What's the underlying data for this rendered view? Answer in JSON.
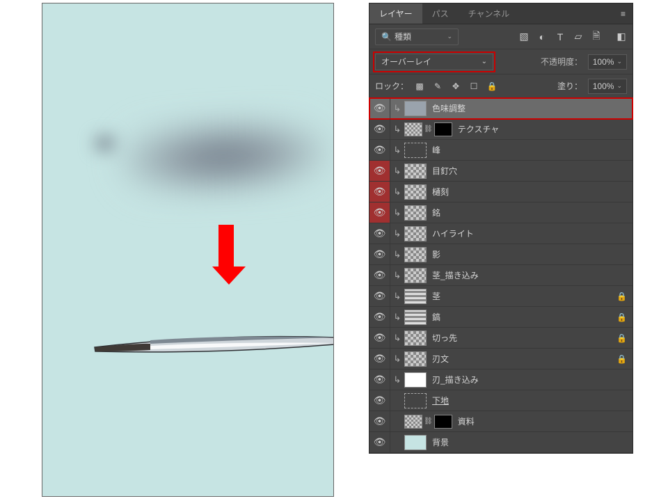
{
  "canvas": {
    "arrow_color": "#ff0000"
  },
  "panel": {
    "tabs": {
      "layers": "レイヤー",
      "paths": "パス",
      "channels": "チャンネル"
    },
    "filter": {
      "kind_label": "種類"
    },
    "blend": {
      "mode": "オーバーレイ",
      "opacity_label": "不透明度：",
      "opacity_value": "100%"
    },
    "lock": {
      "label": "ロック：",
      "fill_label": "塗り：",
      "fill_value": "100%"
    },
    "layers": [
      {
        "name": "色味調整",
        "selected": true,
        "toggled": false,
        "clip": true,
        "thumb": "gray",
        "locked": false
      },
      {
        "name": "テクスチャ",
        "selected": false,
        "toggled": false,
        "clip": true,
        "thumb": "linkmask",
        "locked": false
      },
      {
        "name": "峰",
        "selected": false,
        "toggled": false,
        "clip": true,
        "thumb": "artboard",
        "locked": false
      },
      {
        "name": "目釘穴",
        "selected": false,
        "toggled": true,
        "clip": true,
        "thumb": "checker",
        "locked": false
      },
      {
        "name": "樋刻",
        "selected": false,
        "toggled": true,
        "clip": true,
        "thumb": "checker",
        "locked": false
      },
      {
        "name": "銘",
        "selected": false,
        "toggled": true,
        "clip": true,
        "thumb": "checker",
        "locked": false
      },
      {
        "name": "ハイライト",
        "selected": false,
        "toggled": false,
        "clip": true,
        "thumb": "checker",
        "locked": false
      },
      {
        "name": "影",
        "selected": false,
        "toggled": false,
        "clip": true,
        "thumb": "checker",
        "locked": false
      },
      {
        "name": "茎_描き込み",
        "selected": false,
        "toggled": false,
        "clip": true,
        "thumb": "checker",
        "locked": false
      },
      {
        "name": "茎",
        "selected": false,
        "toggled": false,
        "clip": true,
        "thumb": "dash",
        "locked": true
      },
      {
        "name": "鎬",
        "selected": false,
        "toggled": false,
        "clip": true,
        "thumb": "dash",
        "locked": true
      },
      {
        "name": "切っ先",
        "selected": false,
        "toggled": false,
        "clip": true,
        "thumb": "checker",
        "locked": true
      },
      {
        "name": "刃文",
        "selected": false,
        "toggled": false,
        "clip": true,
        "thumb": "checker",
        "locked": true
      },
      {
        "name": "刃_描き込み",
        "selected": false,
        "toggled": false,
        "clip": true,
        "thumb": "white",
        "locked": false
      },
      {
        "name": "下地",
        "selected": false,
        "toggled": false,
        "clip": false,
        "thumb": "artboard",
        "locked": false,
        "underline": true
      },
      {
        "name": "資料",
        "selected": false,
        "toggled": false,
        "clip": false,
        "thumb": "linkmask",
        "locked": false
      },
      {
        "name": "背景",
        "selected": false,
        "toggled": false,
        "clip": false,
        "thumb": "bgc",
        "locked": false
      }
    ]
  }
}
